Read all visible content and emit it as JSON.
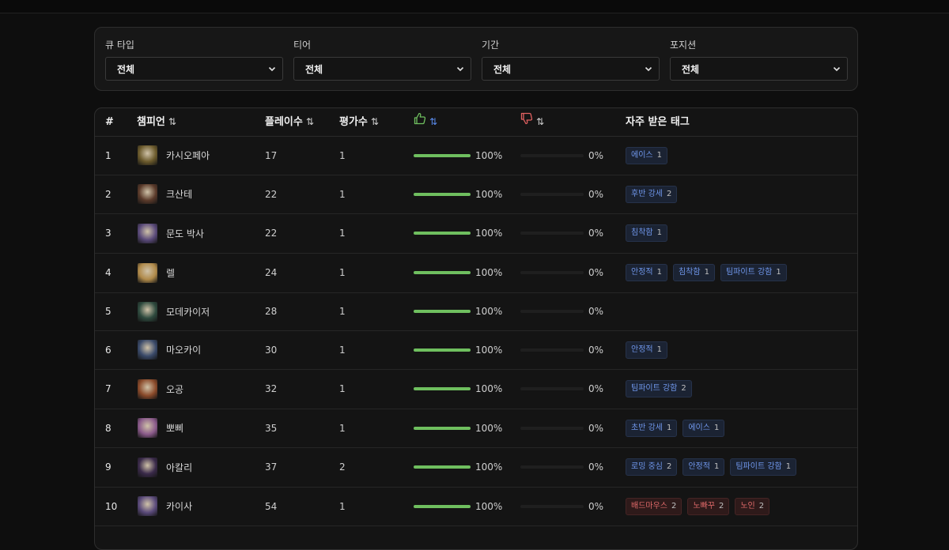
{
  "filters": [
    {
      "label": "큐 타입",
      "value": "전체"
    },
    {
      "label": "티어",
      "value": "전체"
    },
    {
      "label": "기간",
      "value": "전체"
    },
    {
      "label": "포지션",
      "value": "전체"
    }
  ],
  "table": {
    "headers": {
      "rank": "#",
      "champion": "챔피언",
      "plays": "플레이수",
      "ratings": "평가수",
      "tags": "자주 받은 태그",
      "sort_symbol": "⇅"
    },
    "rows": [
      {
        "rank": "1",
        "name": "카시오페아",
        "plays": "17",
        "ratings": "1",
        "like_pct": "100%",
        "like_val": 1.0,
        "dislike_pct": "0%",
        "dislike_val": 0,
        "avatar_color": "#6b5a2c",
        "tags": [
          {
            "text": "에이스",
            "count": "1",
            "kind": "pos"
          }
        ]
      },
      {
        "rank": "2",
        "name": "크산테",
        "plays": "22",
        "ratings": "1",
        "like_pct": "100%",
        "like_val": 1.0,
        "dislike_pct": "0%",
        "dislike_val": 0,
        "avatar_color": "#5a3a2a",
        "tags": [
          {
            "text": "후반 강세",
            "count": "2",
            "kind": "pos"
          }
        ]
      },
      {
        "rank": "3",
        "name": "문도 박사",
        "plays": "22",
        "ratings": "1",
        "like_pct": "100%",
        "like_val": 1.0,
        "dislike_pct": "0%",
        "dislike_val": 0,
        "avatar_color": "#5a4a7a",
        "tags": [
          {
            "text": "침착함",
            "count": "1",
            "kind": "pos"
          }
        ]
      },
      {
        "rank": "4",
        "name": "렐",
        "plays": "24",
        "ratings": "1",
        "like_pct": "100%",
        "like_val": 1.0,
        "dislike_pct": "0%",
        "dislike_val": 0,
        "avatar_color": "#b08a4a",
        "tags": [
          {
            "text": "안정적",
            "count": "1",
            "kind": "pos"
          },
          {
            "text": "침착함",
            "count": "1",
            "kind": "pos"
          },
          {
            "text": "팀파이트 강함",
            "count": "1",
            "kind": "pos"
          }
        ]
      },
      {
        "rank": "5",
        "name": "모데카이저",
        "plays": "28",
        "ratings": "1",
        "like_pct": "100%",
        "like_val": 1.0,
        "dislike_pct": "0%",
        "dislike_val": 0,
        "avatar_color": "#2e4a3e",
        "tags": []
      },
      {
        "rank": "6",
        "name": "마오카이",
        "plays": "30",
        "ratings": "1",
        "like_pct": "100%",
        "like_val": 1.0,
        "dislike_pct": "0%",
        "dislike_val": 0,
        "avatar_color": "#3a4a6a",
        "tags": [
          {
            "text": "안정적",
            "count": "1",
            "kind": "pos"
          }
        ]
      },
      {
        "rank": "7",
        "name": "오공",
        "plays": "32",
        "ratings": "1",
        "like_pct": "100%",
        "like_val": 1.0,
        "dislike_pct": "0%",
        "dislike_val": 0,
        "avatar_color": "#8a4a2a",
        "tags": [
          {
            "text": "팀파이트 강함",
            "count": "2",
            "kind": "pos"
          }
        ]
      },
      {
        "rank": "8",
        "name": "뽀삐",
        "plays": "35",
        "ratings": "1",
        "like_pct": "100%",
        "like_val": 1.0,
        "dislike_pct": "0%",
        "dislike_val": 0,
        "avatar_color": "#8a5a8a",
        "tags": [
          {
            "text": "초반 강세",
            "count": "1",
            "kind": "pos"
          },
          {
            "text": "에이스",
            "count": "1",
            "kind": "pos"
          }
        ]
      },
      {
        "rank": "9",
        "name": "아칼리",
        "plays": "37",
        "ratings": "2",
        "like_pct": "100%",
        "like_val": 1.0,
        "dislike_pct": "0%",
        "dislike_val": 0,
        "avatar_color": "#3a2a4a",
        "tags": [
          {
            "text": "로밍 중심",
            "count": "2",
            "kind": "pos"
          },
          {
            "text": "안정적",
            "count": "1",
            "kind": "pos"
          },
          {
            "text": "팀파이트 강함",
            "count": "1",
            "kind": "pos"
          }
        ]
      },
      {
        "rank": "10",
        "name": "카이사",
        "plays": "54",
        "ratings": "1",
        "like_pct": "100%",
        "like_val": 1.0,
        "dislike_pct": "0%",
        "dislike_val": 0,
        "avatar_color": "#5a4a7a",
        "tags": [
          {
            "text": "배드마우스",
            "count": "2",
            "kind": "neg"
          },
          {
            "text": "노빠꾸",
            "count": "2",
            "kind": "neg"
          },
          {
            "text": "노인",
            "count": "2",
            "kind": "neg"
          }
        ]
      }
    ]
  },
  "colors": {
    "like": "#6fbf5f",
    "dislike": "#c95454",
    "accent": "#5b8def"
  },
  "icons": {
    "like": "thumbs-up-icon",
    "dislike": "thumbs-down-icon",
    "sort": "sort-icon",
    "select": "chevron-down-icon"
  }
}
